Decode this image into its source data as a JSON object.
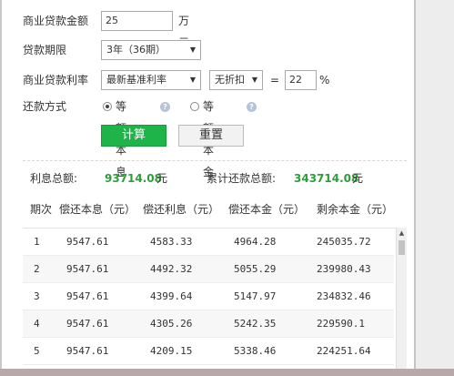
{
  "form": {
    "amount_label": "商业贷款金额",
    "amount_value": "25",
    "amount_unit": "万元",
    "term_label": "贷款期限",
    "term_value": "3年（36期）",
    "rate_label": "商业贷款利率",
    "rate_type_value": "最新基准利率",
    "discount_value": "无折扣",
    "equals_sign": "=",
    "rate_value": "22",
    "rate_unit": "%",
    "method_label": "还款方式",
    "method_options": [
      {
        "label": "等额本息",
        "selected": true
      },
      {
        "label": "等额本金",
        "selected": false
      }
    ],
    "help_icon": "question-icon",
    "calculate_label": "计算",
    "reset_label": "重置"
  },
  "summary": {
    "interest_label": "利息总额:",
    "interest_value": "93714.08",
    "interest_unit": "元",
    "total_label": "累计还款总额:",
    "total_value": "343714.08",
    "total_unit": "元"
  },
  "table": {
    "headers": [
      "期次",
      "偿还本息（元）",
      "偿还利息（元）",
      "偿还本金（元）",
      "剩余本金（元）"
    ],
    "rows": [
      [
        "1",
        "9547.61",
        "4583.33",
        "4964.28",
        "245035.72"
      ],
      [
        "2",
        "9547.61",
        "4492.32",
        "5055.29",
        "239980.43"
      ],
      [
        "3",
        "9547.61",
        "4399.64",
        "5147.97",
        "234832.46"
      ],
      [
        "4",
        "9547.61",
        "4305.26",
        "5242.35",
        "229590.1"
      ],
      [
        "5",
        "9547.61",
        "4209.15",
        "5338.46",
        "224251.64"
      ]
    ]
  },
  "colors": {
    "accent_green": "#1fb449",
    "value_green": "#2c9e3a"
  }
}
